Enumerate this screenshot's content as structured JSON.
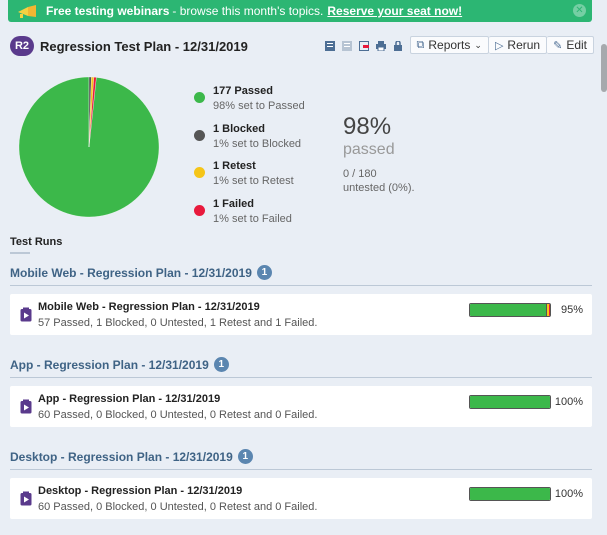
{
  "banner": {
    "strong": "Free testing webinars",
    "text": " - browse this month's topics.",
    "link": "Reserve your seat now!"
  },
  "header": {
    "badge": "R2",
    "title": "Regression Test Plan - 12/31/2019",
    "reports_label": "Reports",
    "rerun_label": "Rerun",
    "edit_label": "Edit"
  },
  "summary": {
    "legend": [
      {
        "title": "177 Passed",
        "sub": "98% set to Passed",
        "color": "#3cb84a"
      },
      {
        "title": "1 Blocked",
        "sub": "1% set to Blocked",
        "color": "#555555"
      },
      {
        "title": "1 Retest",
        "sub": "1% set to Retest",
        "color": "#f5c518"
      },
      {
        "title": "1 Failed",
        "sub": "1% set to Failed",
        "color": "#e8193c"
      }
    ],
    "percent": "98%",
    "percent_label": "passed",
    "count": "0 / 180",
    "untested": "untested (0%)."
  },
  "chart_data": {
    "type": "pie",
    "labels": [
      "Passed",
      "Blocked",
      "Retest",
      "Failed"
    ],
    "values": [
      177,
      1,
      1,
      1
    ],
    "colors": [
      "#3cb84a",
      "#555555",
      "#f5c518",
      "#e8193c"
    ]
  },
  "runs": {
    "heading": "Test Runs",
    "groups": [
      {
        "title": "Mobile Web - Regression Plan - 12/31/2019",
        "count": "1",
        "run_name": "Mobile Web - Regression Plan - 12/31/2019",
        "run_desc": "57 Passed, 1 Blocked, 0 Untested, 1 Retest and 1 Failed.",
        "percent": "95%",
        "progress": {
          "passed": 57,
          "blocked": 1,
          "retest": 1,
          "failed": 1,
          "total": 60
        }
      },
      {
        "title": "App - Regression Plan - 12/31/2019",
        "count": "1",
        "run_name": "App - Regression Plan - 12/31/2019",
        "run_desc": "60 Passed, 0 Blocked, 0 Untested, 0 Retest and 0 Failed.",
        "percent": "100%",
        "progress": {
          "passed": 60,
          "blocked": 0,
          "retest": 0,
          "failed": 0,
          "total": 60
        }
      },
      {
        "title": "Desktop - Regression Plan - 12/31/2019",
        "count": "1",
        "run_name": "Desktop - Regression Plan - 12/31/2019",
        "run_desc": "60 Passed, 0 Blocked, 0 Untested, 0 Retest and 0 Failed.",
        "percent": "100%",
        "progress": {
          "passed": 60,
          "blocked": 0,
          "retest": 0,
          "failed": 0,
          "total": 60
        }
      }
    ]
  }
}
